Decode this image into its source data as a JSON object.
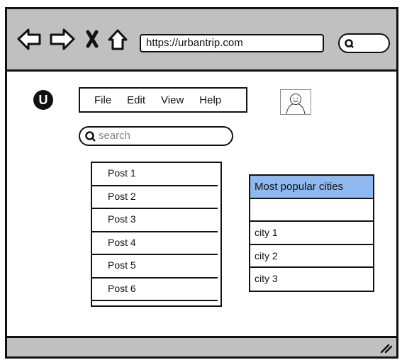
{
  "browser": {
    "url": "https://urbantrip.com",
    "icons": [
      "back-arrow-icon",
      "forward-arrow-icon",
      "close-x-icon",
      "home-icon",
      "search-icon"
    ]
  },
  "app": {
    "logo_letter": "U"
  },
  "menu": {
    "items": [
      "File",
      "Edit",
      "View",
      "Help"
    ]
  },
  "search": {
    "placeholder": "search"
  },
  "posts": [
    "Post 1",
    "Post 2",
    "Post 3",
    "Post 4",
    "Post 5",
    "Post 6"
  ],
  "cities": {
    "header": "Most popular cities",
    "header_color": "#8fb8ee",
    "rows": [
      "",
      "city 1",
      "city 2",
      "city 3"
    ]
  }
}
